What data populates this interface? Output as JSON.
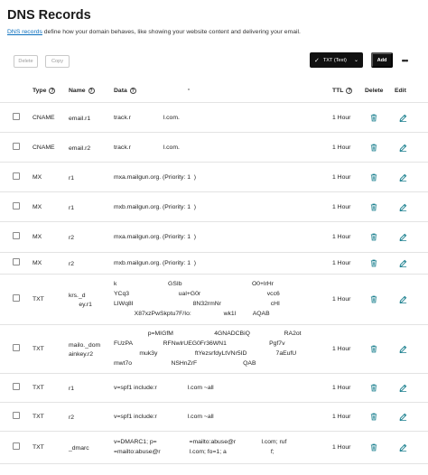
{
  "page": {
    "title": "DNS Records",
    "description_link": "DNS records",
    "description_rest": " define how your domain behaves, like showing your website content and delivering your email."
  },
  "toolbar": {
    "delete_label": "Delete",
    "copy_label": "Copy",
    "filter_label": "TXT (Text)",
    "add_label": "Add",
    "more_label": "•••"
  },
  "columns": {
    "type": "Type",
    "name": "Name",
    "data": "Data",
    "ttl": "TTL",
    "delete": "Delete",
    "edit": "Edit"
  },
  "colors": {
    "accent_link": "#0a6ebd",
    "action_icon": "#1a7f8e",
    "primary_button": "#111111"
  },
  "icons": {
    "trash": "trash-icon",
    "edit": "pencil-icon",
    "info": "info-circle-icon",
    "filter_check": "check-icon"
  },
  "records": [
    {
      "type": "CNAME",
      "name": "email.r1",
      "data_lines": [
        "track.r                   l.com."
      ],
      "ttl": "1 Hour"
    },
    {
      "type": "CNAME",
      "name": "email.r2",
      "data_lines": [
        "track.r                   l.com."
      ],
      "ttl": "1 Hour"
    },
    {
      "type": "MX",
      "name": "r1",
      "data_lines": [
        "mxa.mailgun.org. (Priority: 1  )"
      ],
      "ttl": "1 Hour"
    },
    {
      "type": "MX",
      "name": "r1",
      "data_lines": [
        "mxb.mailgun.org. (Priority: 1  )"
      ],
      "ttl": "1 Hour"
    },
    {
      "type": "MX",
      "name": "r2",
      "data_lines": [
        "mxa.mailgun.org. (Priority: 1  )"
      ],
      "ttl": "1 Hour"
    },
    {
      "type": "MX",
      "name": "r2",
      "data_lines": [
        "mxb.mailgun.org. (Priority: 1  )"
      ],
      "ttl": "1 Hour"
    },
    {
      "type": "TXT",
      "name": "krs._d\n      ey.r1",
      "data_lines": [
        "k                              GSIb                                         O0+lrHr",
        "YCq3                             ual+G0r                                       vcc6",
        "LIWq8I                                   8N32rmNr                             cHI",
        "            X87xzPwSkptu7F/Io:                   wk1l          AQAB"
      ],
      "ttl": "1 Hour"
    },
    {
      "type": "TXT",
      "name": "mailo._dom\nainkey.r2",
      "data_lines": [
        "                    p=MIGfM                        4GNADCBiQ                    RA2ot",
        "FUzPA                  RFNwlrUEG0Fr36WN1                         Pgf7v",
        "               muk3y                      ftYezsrfdyLtVNr5ID                 7aEufU",
        "mwt7o                       NSHnZrF                           QAB"
      ],
      "ttl": "1 Hour"
    },
    {
      "type": "TXT",
      "name": "r1",
      "data_lines": [
        "v=spf1 include:r                  l.com ~all"
      ],
      "ttl": "1 Hour"
    },
    {
      "type": "TXT",
      "name": "r2",
      "data_lines": [
        "v=spf1 include:r                  l.com ~all"
      ],
      "ttl": "1 Hour"
    },
    {
      "type": "TXT",
      "name": "_dmarc",
      "data_lines": [
        "v=DMARC1; p=                   =mailto:abuse@r               l.com; ruf",
        "=mailto:abuse@r                 l.com; fo=1; a                          f;"
      ],
      "ttl": "1 Hour"
    }
  ]
}
